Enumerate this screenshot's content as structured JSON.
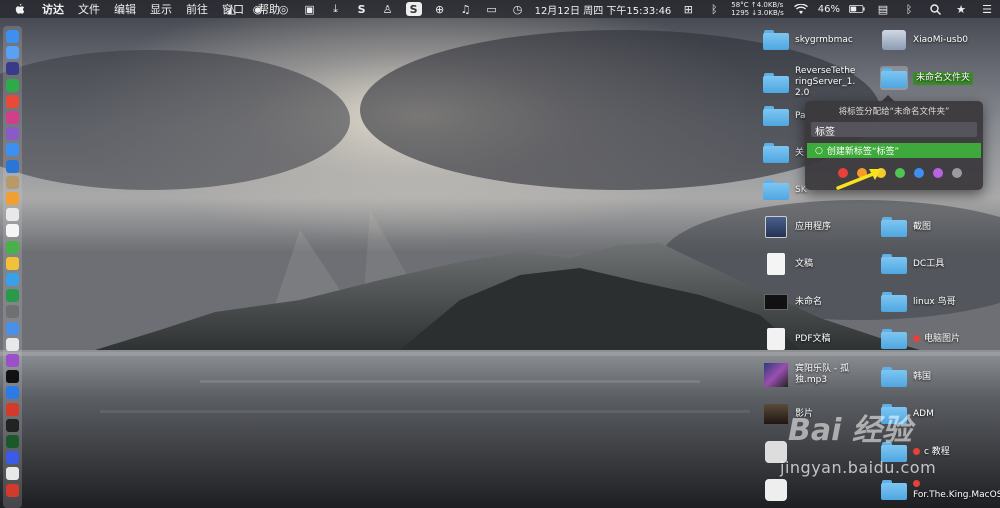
{
  "menubar": {
    "app_name": "访达",
    "items": [
      "文件",
      "编辑",
      "显示",
      "前往",
      "窗口",
      "帮助"
    ],
    "cpu_temp": "58°C",
    "cpu_rpm": "1295",
    "net_up": "↑4.0KB/s",
    "net_down": "↓3.0KB/s",
    "datetime": "12月12日 周四 下午15:33:46",
    "battery": "46%"
  },
  "status_icons": [
    "fox-icon",
    "chat-icon",
    "record-icon",
    "camera-icon",
    "download-icon",
    "s-app-icon",
    "qq-icon",
    "s-app2-icon",
    "globe-icon",
    "music-icon",
    "message-icon",
    "clock-icon",
    "windows-icon",
    "bluetooth-icon",
    "wifi-icon",
    "battery-icon",
    "siri-icon",
    "bluetooth2-icon",
    "search-icon",
    "star-icon",
    "list-icon"
  ],
  "desktop": {
    "items_left_col": [
      {
        "label": "skygrmbmac",
        "icon": "folder"
      },
      {
        "label": "ReverseTetheringServer_1.2.0",
        "icon": "folder"
      },
      {
        "label": "Pa",
        "icon": "folder"
      },
      {
        "label": "关",
        "icon": "folder"
      },
      {
        "label": "SK",
        "icon": "folder"
      },
      {
        "label": "应用程序",
        "icon": "apps"
      },
      {
        "label": "文稿",
        "icon": "doc"
      },
      {
        "label": "未命名",
        "icon": "dark"
      },
      {
        "label": "PDF文稿",
        "icon": "pdf"
      },
      {
        "label": "宾阳乐队 - 孤独.mp3",
        "icon": "media"
      },
      {
        "label": "影片",
        "icon": "movie"
      },
      {
        "label": "",
        "icon": "app"
      },
      {
        "label": "",
        "icon": "app2"
      }
    ],
    "items_right_col": [
      {
        "label": "XiaoMi-usb0",
        "icon": "server",
        "tagged": false
      },
      {
        "label": "未命名文件夹",
        "icon": "folder-selected",
        "tagged": false,
        "selected": true
      },
      {
        "label": "截图",
        "icon": "folder",
        "tagged": false
      },
      {
        "label": "DC工具",
        "icon": "folder",
        "tagged": false
      },
      {
        "label": "linux 鸟哥",
        "icon": "folder",
        "tagged": false
      },
      {
        "label": "电脑图片",
        "icon": "folder",
        "tagged": true
      },
      {
        "label": "韩国",
        "icon": "folder",
        "tagged": false
      },
      {
        "label": "ADM",
        "icon": "folder",
        "tagged": false
      },
      {
        "label": "c 教程",
        "icon": "folder",
        "tagged": true
      },
      {
        "label": "For.The.King.MacOS...iVATED",
        "icon": "folder",
        "tagged": true
      }
    ]
  },
  "tag_popover": {
    "title": "将标签分配给“未命名文件夹”",
    "input_value": "标签",
    "suggestion": "创建新标签“标签”",
    "colors": [
      "#e8413a",
      "#f49b2c",
      "#f3cc2c",
      "#4fc454",
      "#3f8ff0",
      "#b664e0",
      "#9b9b9f"
    ]
  },
  "watermark": {
    "brand": "Bai 经验",
    "url": "jingyan.baidu.com"
  }
}
